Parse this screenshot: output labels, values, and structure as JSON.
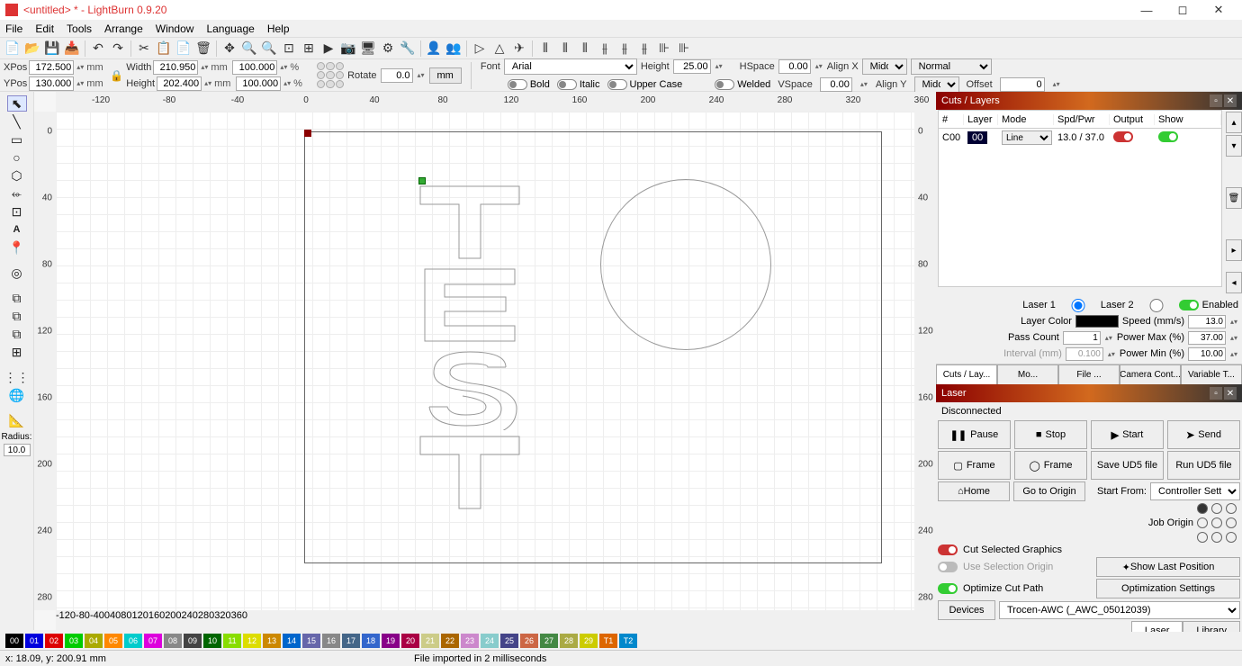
{
  "title": "<untitled> * - LightBurn 0.9.20",
  "menus": [
    "File",
    "Edit",
    "Tools",
    "Arrange",
    "Window",
    "Language",
    "Help"
  ],
  "props": {
    "xpos_lbl": "XPos",
    "xpos": "172.500",
    "ypos_lbl": "YPos",
    "ypos": "130.000",
    "width_lbl": "Width",
    "width": "210.950",
    "height_lbl": "Height",
    "height": "202.400",
    "scale_w": "100.000",
    "scale_h": "100.000",
    "unit": "mm",
    "pct": "%",
    "rotate_lbl": "Rotate",
    "rotate": "0.0",
    "mm_btn": "mm"
  },
  "text": {
    "font_lbl": "Font",
    "font": "Arial",
    "height_lbl": "Height",
    "height": "25.00",
    "hspace_lbl": "HSpace",
    "hspace": "0.00",
    "vspace_lbl": "VSpace",
    "vspace": "0.00",
    "alignx_lbl": "Align X",
    "alignx": "Middle",
    "aligny_lbl": "Align Y",
    "aligny": "Middle",
    "style": "Normal",
    "offset_lbl": "Offset",
    "offset": "0",
    "bold": "Bold",
    "italic": "Italic",
    "upper": "Upper Case",
    "welded": "Welded"
  },
  "ruler_ticks": [
    "-120",
    "-80",
    "-40",
    "0",
    "40",
    "80",
    "120",
    "160",
    "200",
    "240",
    "280",
    "320",
    "360"
  ],
  "ruler_v": [
    "0",
    "40",
    "80",
    "120",
    "160",
    "200",
    "240",
    "280"
  ],
  "left_tools": {
    "radius_lbl": "Radius:",
    "radius": "10.0"
  },
  "cuts": {
    "title": "Cuts / Layers",
    "cols": {
      "num": "#",
      "layer": "Layer",
      "mode": "Mode",
      "spd": "Spd/Pwr",
      "output": "Output",
      "show": "Show"
    },
    "row": {
      "num": "C00",
      "layer": "00",
      "mode": "Line",
      "spd": "13.0 / 37.0"
    },
    "laser1": "Laser 1",
    "laser2": "Laser 2",
    "enabled": "Enabled",
    "layer_color": "Layer Color",
    "speed": "Speed (mm/s)",
    "speed_v": "13.0",
    "pass": "Pass Count",
    "pass_v": "1",
    "pmax": "Power Max (%)",
    "pmax_v": "37.00",
    "interval": "Interval (mm)",
    "interval_v": "0.100",
    "pmin": "Power Min (%)",
    "pmin_v": "10.00",
    "tabs": [
      "Cuts / Lay...",
      "Mo...",
      "File ...",
      "Camera Cont...",
      "Variable T..."
    ]
  },
  "laser": {
    "title": "Laser",
    "status": "Disconnected",
    "pause": "Pause",
    "stop": "Stop",
    "start": "Start",
    "send": "Send",
    "frame": "Frame",
    "frame2": "Frame",
    "save": "Save UD5 file",
    "run": "Run UD5 file",
    "home": "Home",
    "goto": "Go to Origin",
    "startfrom": "Start From:",
    "startfrom_v": "Controller Setting",
    "joborigin": "Job Origin",
    "cutsel": "Cut Selected Graphics",
    "usesel": "Use Selection Origin",
    "opt": "Optimize Cut Path",
    "showlast": "Show Last Position",
    "optset": "Optimization Settings",
    "devices": "Devices",
    "device": "Trocen-AWC (_AWC_05012039)",
    "btabs": [
      "Laser",
      "Library"
    ]
  },
  "colors": [
    {
      "n": "00",
      "c": "#000"
    },
    {
      "n": "01",
      "c": "#00d"
    },
    {
      "n": "02",
      "c": "#d00"
    },
    {
      "n": "03",
      "c": "#0c0"
    },
    {
      "n": "04",
      "c": "#aa0"
    },
    {
      "n": "05",
      "c": "#f80"
    },
    {
      "n": "06",
      "c": "#0cc"
    },
    {
      "n": "07",
      "c": "#d0d"
    },
    {
      "n": "08",
      "c": "#888"
    },
    {
      "n": "09",
      "c": "#444"
    },
    {
      "n": "10",
      "c": "#060"
    },
    {
      "n": "11",
      "c": "#8d0"
    },
    {
      "n": "12",
      "c": "#dd0"
    },
    {
      "n": "13",
      "c": "#c80"
    },
    {
      "n": "14",
      "c": "#06c"
    },
    {
      "n": "15",
      "c": "#66a"
    },
    {
      "n": "16",
      "c": "#888"
    },
    {
      "n": "17",
      "c": "#468"
    },
    {
      "n": "18",
      "c": "#36c"
    },
    {
      "n": "19",
      "c": "#808"
    },
    {
      "n": "20",
      "c": "#a04"
    },
    {
      "n": "21",
      "c": "#cc8"
    },
    {
      "n": "22",
      "c": "#a60"
    },
    {
      "n": "23",
      "c": "#c8c"
    },
    {
      "n": "24",
      "c": "#8cc"
    },
    {
      "n": "25",
      "c": "#448"
    },
    {
      "n": "26",
      "c": "#c64"
    },
    {
      "n": "27",
      "c": "#484"
    },
    {
      "n": "28",
      "c": "#aa4"
    },
    {
      "n": "29",
      "c": "#cc0"
    },
    {
      "n": "T1",
      "c": "#d60"
    },
    {
      "n": "T2",
      "c": "#08c"
    }
  ],
  "status": {
    "coords": "x: 18.09, y: 200.91 mm",
    "msg": "File imported in 2 milliseconds"
  }
}
